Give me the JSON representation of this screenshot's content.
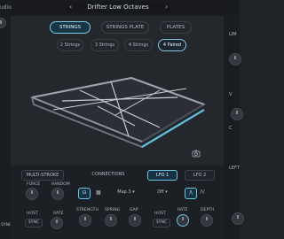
{
  "header": {
    "left_label": "udio",
    "preset": "Drifter Low Octaves"
  },
  "top_tabs": [
    {
      "label": "STRINGS",
      "active": true
    },
    {
      "label": "STRINGS PLATE",
      "active": false
    },
    {
      "label": "PLATES",
      "active": false
    }
  ],
  "string_modes": [
    {
      "label": "2 Strings",
      "active": false
    },
    {
      "label": "3 Strings",
      "active": false
    },
    {
      "label": "4 Strings",
      "active": false
    },
    {
      "label": "4 Paired",
      "active": true
    }
  ],
  "bottom": {
    "multi_stroke": "MULTI-STROKE",
    "connections": "CONNECTIONS",
    "lfo1": "LFO 1",
    "lfo2": "LFO 2",
    "map": "Map 3",
    "off": "Off",
    "labels": {
      "force": "FORCE",
      "random": "RANDOM",
      "host": "HOST",
      "rate": "RATE",
      "sync": "SYNC",
      "strength": "STRENGTH",
      "spring": "SPRING",
      "gap": "GAP",
      "depth": "DEPTH"
    }
  },
  "right_labels": {
    "top": "LIM",
    "mid": "V",
    "c": "C",
    "left": "LEFT"
  },
  "left_labels": {
    "bottom": "SYNC"
  },
  "colors": {
    "accent": "#7dc8e8",
    "plate_edge": "#62bfdc"
  }
}
